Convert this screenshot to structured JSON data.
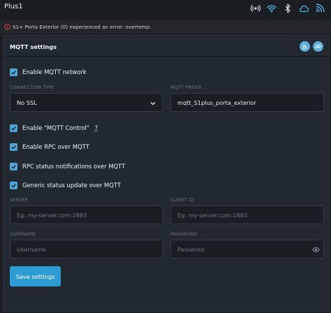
{
  "app": {
    "title": "Plus1"
  },
  "status_icons": [
    "radio-signal-icon",
    "wifi-icon",
    "bluetooth-icon",
    "cloud-icon",
    "mqtt-icon"
  ],
  "alert": {
    "message": "S1+ Porta Exterior (0) experienced an error: overtemp."
  },
  "mqtt": {
    "title": "MQTT settings",
    "enable_label": "Enable MQTT network",
    "connection_type_label": "CONNECTION TYPE",
    "connection_type_value": "No SSL",
    "prefix_label": "MQTT PREFIX",
    "prefix_value": "mqtt_S1plus_porta_exterior",
    "mqtt_control_label": "Enable \"MQTT Control\"",
    "help_mark": "?",
    "rpc_label": "Enable RPC over MQTT",
    "rpc_status_label": "RPC status notifications over MQTT",
    "generic_status_label": "Generic status update over MQTT",
    "server_label": "SERVER",
    "server_placeholder": "Eg: my-server.com:1883",
    "client_id_label": "CLIENT ID",
    "client_id_placeholder": "Eg: my-server.com:1883",
    "username_label": "USERNAME",
    "username_placeholder": "Username",
    "password_label": "PASSWORD",
    "password_placeholder": "Password",
    "save_label": "Save settings"
  },
  "colors": {
    "background": "#1b1f24",
    "panel": "#22282f",
    "accent": "#2d9bd4",
    "checkbox": "#4fa6d6",
    "error": "#e05252"
  }
}
